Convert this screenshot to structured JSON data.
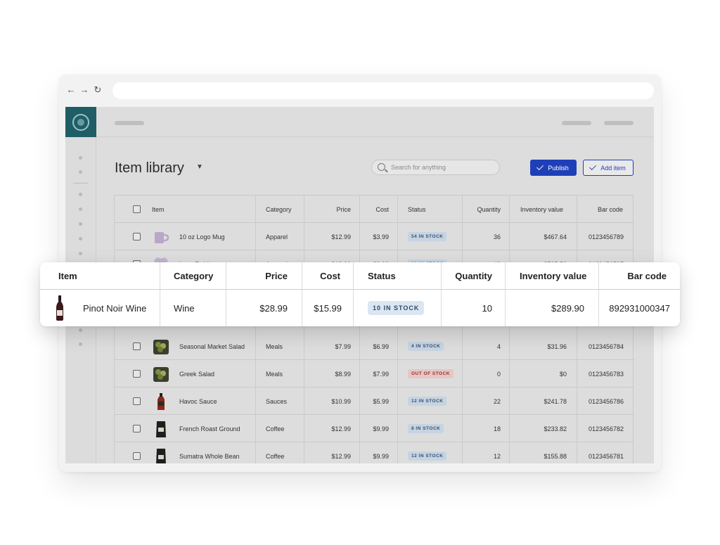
{
  "app": {
    "page_title": "Item library",
    "search_placeholder": "Search for anything",
    "publish_label": "Publish",
    "add_item_label": "Add item"
  },
  "table": {
    "headers": [
      "Item",
      "Category",
      "Price",
      "Cost",
      "Status",
      "Quantity",
      "Inventory value",
      "Bar code"
    ],
    "rows": [
      {
        "item": "10 oz Logo Mug",
        "category": "Apparel",
        "price": "$12.99",
        "cost": "$3.99",
        "status": "54 IN STOCK",
        "quantity": "36",
        "value": "$467.64",
        "barcode": "0123456789",
        "thumb": "mug-icon"
      },
      {
        "item": "Logo T-shirt",
        "category": "Apparel",
        "price": "$18.99",
        "cost": "$3.99",
        "status": "12 IN STOCK",
        "quantity": "42",
        "value": "$797.58",
        "barcode": "0123456787",
        "thumb": "tshirt-icon"
      },
      {
        "item": "Seasonal Market Salad",
        "category": "Meals",
        "price": "$7.99",
        "cost": "$6.99",
        "status": "4 IN STOCK",
        "quantity": "4",
        "value": "$31.96",
        "barcode": "0123456784",
        "thumb": "salad-icon"
      },
      {
        "item": "Greek Salad",
        "category": "Meals",
        "price": "$8.99",
        "cost": "$7.99",
        "status": "OUT OF STOCK",
        "quantity": "0",
        "value": "$0",
        "barcode": "0123456783",
        "thumb": "salad-icon"
      },
      {
        "item": "Havoc Sauce",
        "category": "Sauces",
        "price": "$10.99",
        "cost": "$5.99",
        "status": "12 IN STOCK",
        "quantity": "22",
        "value": "$241.78",
        "barcode": "0123456786",
        "thumb": "sauce-bottle-icon"
      },
      {
        "item": "French Roast Ground",
        "category": "Coffee",
        "price": "$12.99",
        "cost": "$9.99",
        "status": "8 IN STOCK",
        "quantity": "18",
        "value": "$233.82",
        "barcode": "0123456782",
        "thumb": "coffee-bag-icon"
      },
      {
        "item": "Sumatra Whole Bean",
        "category": "Coffee",
        "price": "$12.99",
        "cost": "$9.99",
        "status": "12 IN STOCK",
        "quantity": "12",
        "value": "$155.88",
        "barcode": "0123456781",
        "thumb": "coffee-bag-icon"
      }
    ]
  },
  "highlight": {
    "headers": [
      "Item",
      "Category",
      "Price",
      "Cost",
      "Status",
      "Quantity",
      "Inventory value",
      "Bar code"
    ],
    "item": "Pinot Noir Wine",
    "category": "Wine",
    "price": "$28.99",
    "cost": "$15.99",
    "status": "10 IN STOCK",
    "quantity": "10",
    "value": "$289.90",
    "barcode": "892931000347",
    "thumb": "wine-bottle-icon"
  },
  "colors": {
    "accent": "#1f3fb8",
    "logo_bg": "#1f5e66",
    "in_stock_badge": "#c6d3e2",
    "out_of_stock_badge": "#e8c5c5"
  }
}
